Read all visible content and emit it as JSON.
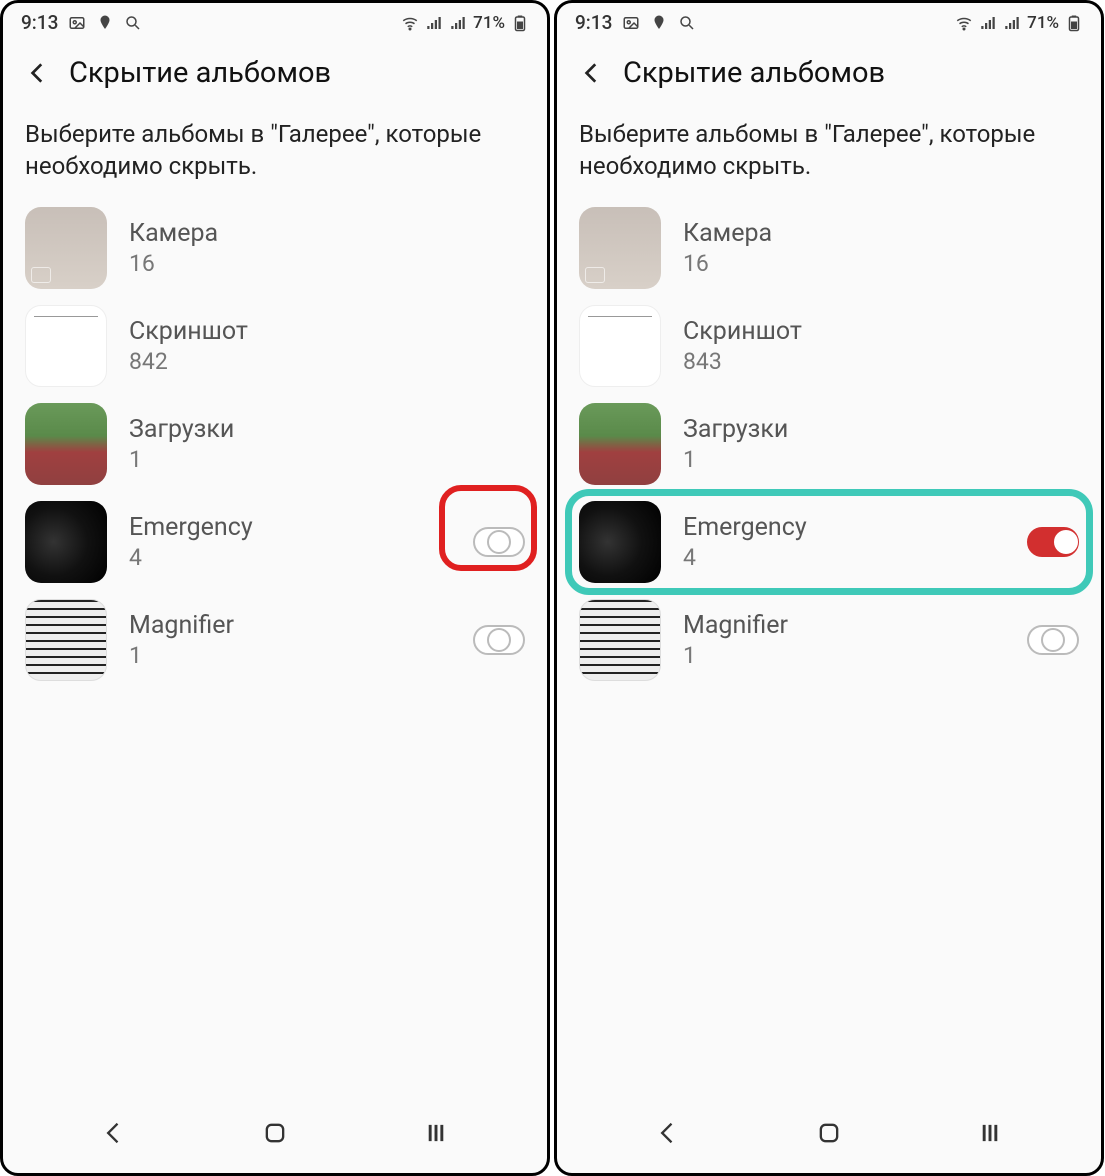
{
  "status": {
    "time": "9:13",
    "battery_pct": "71%"
  },
  "header": {
    "title": "Скрытие альбомов"
  },
  "subtitle": "Выберите альбомы в \"Галерее\", которые необходимо скрыть.",
  "screens": [
    {
      "albums": [
        {
          "name": "Камера",
          "count": "16",
          "thumb": "camera",
          "toggle": null
        },
        {
          "name": "Скриншот",
          "count": "842",
          "thumb": "screenshot",
          "toggle": null
        },
        {
          "name": "Загрузки",
          "count": "1",
          "thumb": "downloads",
          "toggle": null
        },
        {
          "name": "Emergency",
          "count": "4",
          "thumb": "emergency",
          "toggle": "off",
          "highlight": "red"
        },
        {
          "name": "Magnifier",
          "count": "1",
          "thumb": "magnifier",
          "toggle": "off"
        }
      ]
    },
    {
      "albums": [
        {
          "name": "Камера",
          "count": "16",
          "thumb": "camera",
          "toggle": null
        },
        {
          "name": "Скриншот",
          "count": "843",
          "thumb": "screenshot",
          "toggle": null
        },
        {
          "name": "Загрузки",
          "count": "1",
          "thumb": "downloads",
          "toggle": null
        },
        {
          "name": "Emergency",
          "count": "4",
          "thumb": "emergency",
          "toggle": "on",
          "highlight": "teal"
        },
        {
          "name": "Magnifier",
          "count": "1",
          "thumb": "magnifier",
          "toggle": "off"
        }
      ]
    }
  ]
}
